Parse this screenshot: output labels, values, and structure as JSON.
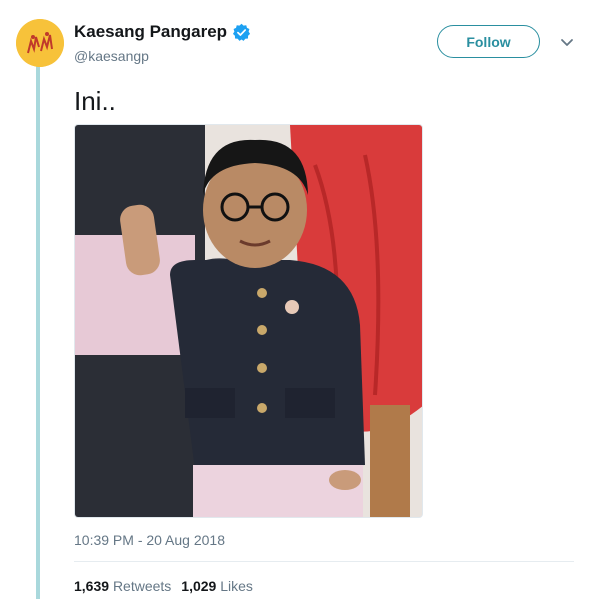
{
  "tweet": {
    "display_name": "Kaesang Pangarep",
    "handle": "@kaesangp",
    "follow_label": "Follow",
    "text": "Ini..",
    "timestamp": "10:39 PM - 20 Aug 2018",
    "stats": {
      "retweets_count": "1,639",
      "retweets_label": "Retweets",
      "likes_count": "1,029",
      "likes_label": "Likes"
    }
  },
  "colors": {
    "accent": "#2a8fa0",
    "verified": "#1da1f2",
    "thread_line": "#a9d8dc",
    "avatar_bg": "#f7c23a"
  },
  "icons": {
    "verified": "verified-badge-icon",
    "caret": "chevron-down-icon"
  }
}
